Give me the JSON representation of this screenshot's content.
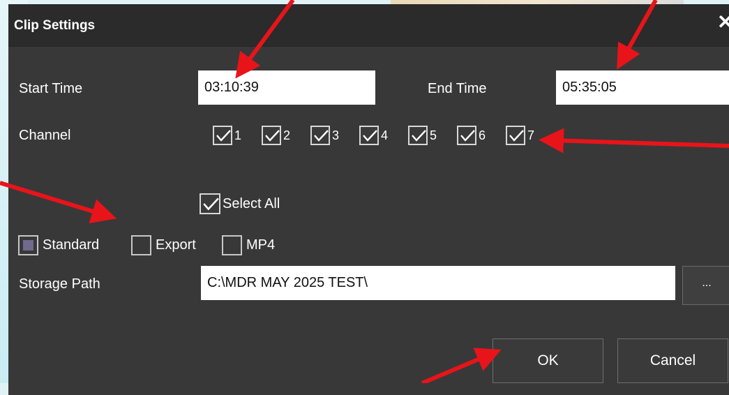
{
  "dialog": {
    "title": "Clip Settings",
    "close_glyph": "✕"
  },
  "start_time": {
    "label": "Start Time",
    "value": "03:10:39"
  },
  "end_time": {
    "label": "End Time",
    "value": "05:35:05"
  },
  "channel": {
    "label": "Channel",
    "items": [
      {
        "number": "1",
        "checked": true
      },
      {
        "number": "2",
        "checked": true
      },
      {
        "number": "3",
        "checked": true
      },
      {
        "number": "4",
        "checked": true
      },
      {
        "number": "5",
        "checked": true
      },
      {
        "number": "6",
        "checked": true
      },
      {
        "number": "7",
        "checked": true
      }
    ]
  },
  "select_all": {
    "label": "Select All",
    "checked": true
  },
  "format_options": [
    {
      "label": "Standard",
      "selected": true
    },
    {
      "label": "Export",
      "selected": false
    },
    {
      "label": "MP4",
      "selected": false
    }
  ],
  "storage_path": {
    "label": "Storage Path",
    "value": "C:\\MDR MAY 2025 TEST\\",
    "browse_label": "..."
  },
  "buttons": {
    "ok": "OK",
    "cancel": "Cancel"
  },
  "colors": {
    "dialog_bg": "#383838",
    "titlebar_bg": "#2b2b2b",
    "annotation_arrow": "#e8141a",
    "standard_fill": "#6f6a8e"
  }
}
